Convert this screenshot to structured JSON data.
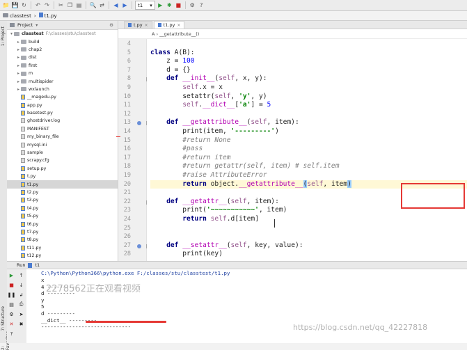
{
  "toolbar": {
    "run_config": "t1",
    "icons": [
      "folder-icon",
      "save-icon",
      "sync-icon",
      "undo-icon",
      "redo-icon",
      "cut-icon",
      "copy-icon",
      "paste-icon",
      "search-icon",
      "replace-icon",
      "back-icon",
      "forward-icon",
      "run-icon",
      "debug-icon",
      "stop-icon",
      "settings-icon",
      "help-icon"
    ]
  },
  "breadcrumb": {
    "folder": "classtest",
    "file": "t1.py"
  },
  "side_tabs": {
    "project": "1: Project",
    "structure": "7: Structure",
    "favorites": "2: Favorites"
  },
  "project_panel": {
    "title": "Project",
    "root_name": "classtest",
    "root_path": "F:\\classes\\stu\\classtest",
    "items": [
      {
        "label": "build",
        "kind": "dir"
      },
      {
        "label": "chap2",
        "kind": "dir"
      },
      {
        "label": "dist",
        "kind": "dir"
      },
      {
        "label": "first",
        "kind": "dir"
      },
      {
        "label": "m",
        "kind": "dir"
      },
      {
        "label": "multispider",
        "kind": "dir"
      },
      {
        "label": "wxlaunch",
        "kind": "dir"
      },
      {
        "label": "__magedu.py",
        "kind": "py"
      },
      {
        "label": "app.py",
        "kind": "py"
      },
      {
        "label": "basetest.py",
        "kind": "py"
      },
      {
        "label": "ghostdriver.log",
        "kind": "file"
      },
      {
        "label": "MANIFEST",
        "kind": "file"
      },
      {
        "label": "my_binary_file",
        "kind": "file"
      },
      {
        "label": "mysql.ini",
        "kind": "file"
      },
      {
        "label": "sample",
        "kind": "file"
      },
      {
        "label": "scrapy.cfg",
        "kind": "file"
      },
      {
        "label": "setup.py",
        "kind": "py"
      },
      {
        "label": "t.py",
        "kind": "py"
      },
      {
        "label": "t1.py",
        "kind": "py",
        "selected": true
      },
      {
        "label": "t2.py",
        "kind": "py"
      },
      {
        "label": "t3.py",
        "kind": "py"
      },
      {
        "label": "t4.py",
        "kind": "py"
      },
      {
        "label": "t5.py",
        "kind": "py"
      },
      {
        "label": "t6.py",
        "kind": "py"
      },
      {
        "label": "t7.py",
        "kind": "py"
      },
      {
        "label": "t8.py",
        "kind": "py"
      },
      {
        "label": "t11.py",
        "kind": "py"
      },
      {
        "label": "t12.py",
        "kind": "py"
      }
    ]
  },
  "editor": {
    "tabs": [
      {
        "label": "t.py",
        "active": false
      },
      {
        "label": "t1.py",
        "active": true
      }
    ],
    "crumb": "A  ›  __getattribute__()",
    "lines": [
      {
        "n": "4",
        "html": ""
      },
      {
        "n": "5",
        "html": "<span class=\"kw\">class</span> A(B):"
      },
      {
        "n": "6",
        "html": "    z = <span class=\"num\">100</span>"
      },
      {
        "n": "7",
        "html": "    d = {}"
      },
      {
        "n": "8",
        "html": "    <span class=\"kw\">def</span> <span class=\"dunder\">__init__</span>(<span class=\"self\">self</span>, x, y):"
      },
      {
        "n": "9",
        "html": "        <span class=\"self\">self</span>.x = x"
      },
      {
        "n": "10",
        "html": "        setattr(<span class=\"self\">self</span>, <span class=\"str\">'y'</span>, y)"
      },
      {
        "n": "11",
        "html": "        <span class=\"self\">self</span>.<span class=\"dunder\">__dict__</span>[<span class=\"str\">'a'</span>] = <span class=\"num\">5</span>"
      },
      {
        "n": "12",
        "html": ""
      },
      {
        "n": "13",
        "html": "    <span class=\"kw\">def</span> <span class=\"dunder\">__getattribute__</span>(<span class=\"self\">self</span>, item):"
      },
      {
        "n": "14",
        "html": "        print(item, <span class=\"str\">'---------'</span>)"
      },
      {
        "n": "15",
        "html": "        <span class=\"cm\">#return None</span>"
      },
      {
        "n": "16",
        "html": "        <span class=\"cm\">#pass</span>"
      },
      {
        "n": "17",
        "html": "        <span class=\"cm\">#return item</span>"
      },
      {
        "n": "18",
        "html": "        <span class=\"cm\">#return getattr(self, item) # self.item</span>"
      },
      {
        "n": "19",
        "html": "        <span class=\"cm\">#raise AttributeError</span>"
      },
      {
        "n": "20",
        "html": "        <span class=\"kw\">return</span> object.<span class=\"dunder\">__getattribute__</span><span class=\"bkt\">(</span><span class=\"self\">self</span>, item<span class=\"bkt\">)</span>",
        "hl": true
      },
      {
        "n": "21",
        "html": ""
      },
      {
        "n": "22",
        "html": "    <span class=\"kw\">def</span> <span class=\"dunder\">__getattr__</span>(<span class=\"self\">self</span>, item):"
      },
      {
        "n": "23",
        "html": "        print(<span class=\"str\">'~~~~~~~~~~~'</span>, item)"
      },
      {
        "n": "24",
        "html": "        <span class=\"kw\">return</span> <span class=\"self\">self</span>.d[item]"
      },
      {
        "n": "25",
        "html": ""
      },
      {
        "n": "26",
        "html": ""
      },
      {
        "n": "27",
        "html": "    <span class=\"kw\">def</span> <span class=\"dunder\">__setattr__</span>(<span class=\"self\">self</span>, key, value):"
      },
      {
        "n": "28",
        "html": "        print(key)"
      }
    ]
  },
  "run_panel": {
    "label": "Run",
    "config": "t1",
    "command": "C:\\Python\\Python366\\python.exe F:/classes/stu/classtest/t1.py",
    "output": [
      "x",
      "4 ---------",
      "d ---------",
      "y",
      "5",
      "d ---------",
      "__dict__ ---------",
      "-----------------------------"
    ]
  },
  "watermarks": {
    "viewer": "2278562正在观看视频",
    "blog": "https://blog.csdn.net/qq_42227818"
  },
  "colors": {
    "annotation_red": "#e53935",
    "keyword": "#000080",
    "string": "#008000",
    "comment": "#808080"
  }
}
